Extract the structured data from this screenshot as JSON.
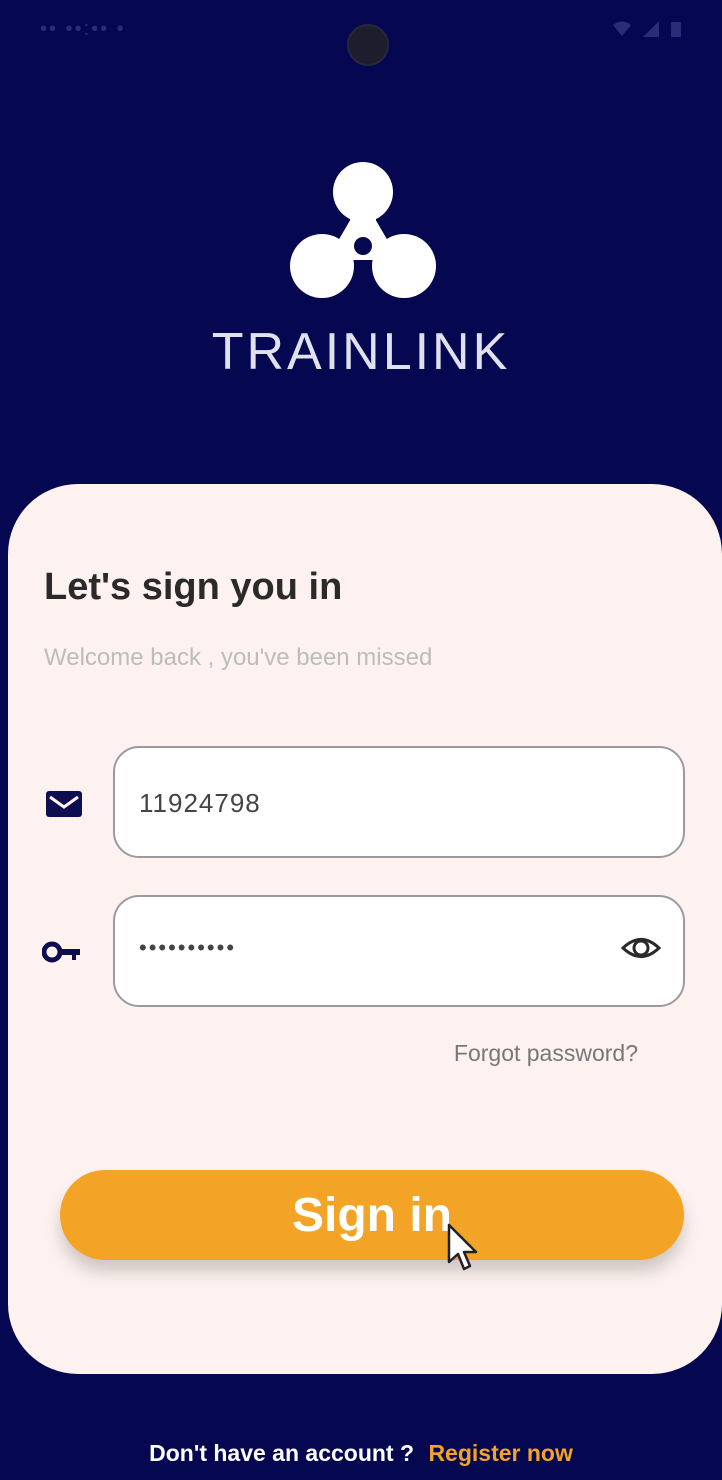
{
  "app": {
    "brand_name": "TRAINLINK",
    "logo_icon": "three-circle-link-icon"
  },
  "status_bar": {
    "left_text": "•• ••:•• •",
    "icons": [
      "wifi-icon",
      "signal-icon",
      "battery-icon"
    ]
  },
  "login": {
    "title": "Let's sign you in",
    "subtitle": "Welcome back , you've been missed",
    "username": {
      "icon": "mail-icon",
      "value": "11924798"
    },
    "password": {
      "icon": "key-icon",
      "value": "••••••••••",
      "toggle_icon": "eye-icon"
    },
    "forgot_label": "Forgot password?",
    "signin_label": "Sign in"
  },
  "footer": {
    "prompt": "Don't have an account ?",
    "register_label": "Register now"
  },
  "colors": {
    "background": "#050750",
    "card": "#fdf2ef",
    "accent": "#f3a325"
  }
}
